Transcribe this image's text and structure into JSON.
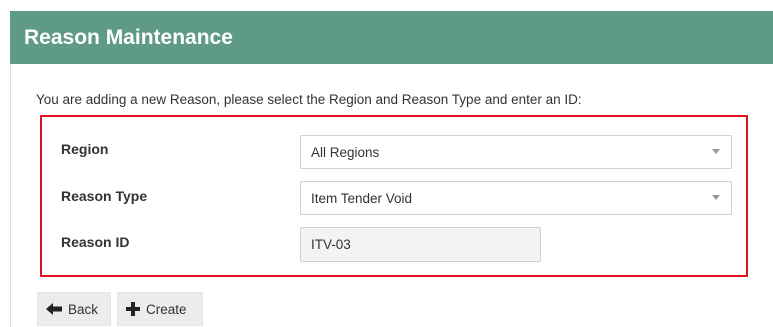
{
  "header": {
    "title": "Reason Maintenance",
    "bg_color": "#5f9a85"
  },
  "form": {
    "intro_text": "You are adding a new Reason, please select the Region and Reason Type and enter an ID:",
    "highlight_color": "#e0121f",
    "region": {
      "label": "Region",
      "selected": "All Regions",
      "icon": "chevron-down-icon"
    },
    "reason_type": {
      "label": "Reason Type",
      "selected": "Item Tender Void",
      "icon": "chevron-down-icon"
    },
    "reason_id": {
      "label": "Reason ID",
      "value": "ITV-03"
    }
  },
  "actions": {
    "back": {
      "label": "Back",
      "icon": "arrow-left-icon"
    },
    "create": {
      "label": "Create",
      "icon": "plus-icon"
    }
  }
}
